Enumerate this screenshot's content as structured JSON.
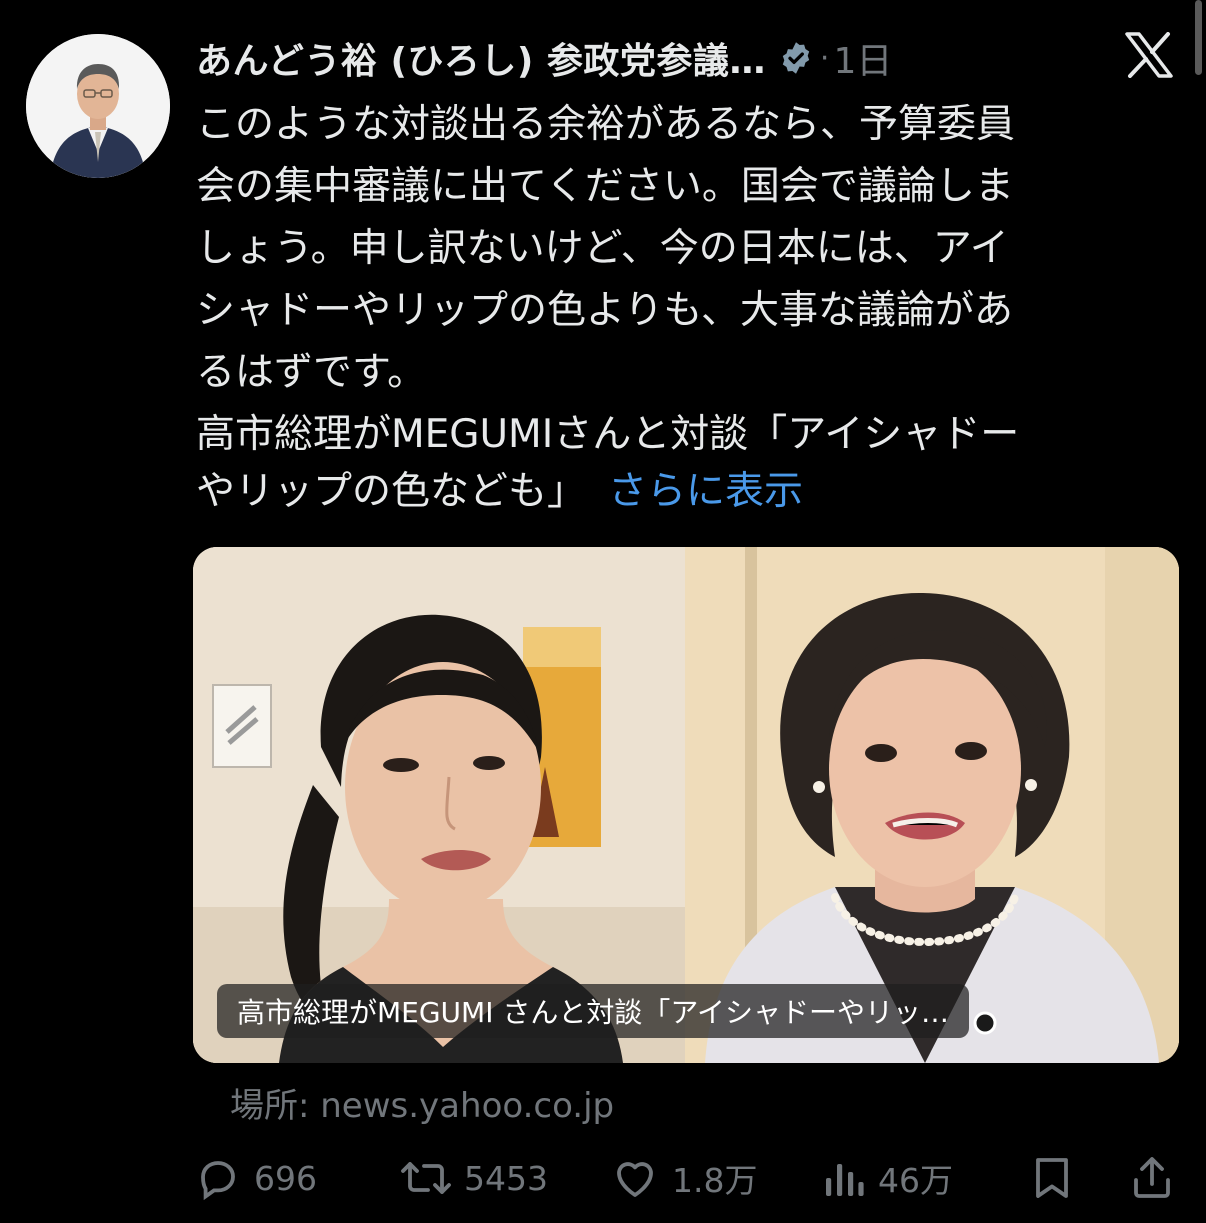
{
  "tweet": {
    "author_name": "あんどう裕 (ひろし) 参政党参議…",
    "separator": "·",
    "time": "1日",
    "body": "このような対談出る余裕があるなら、予算委員\n会の集中審議に出てください。国会で議論しま\nしょう。申し訳ないけど、今の日本には、アイ\nシャドーやリップの色よりも、大事な議論があ\nるはずです。",
    "quote_text_line1": "高市総理がMEGUMIさんと対談「アイシャドー",
    "quote_text_line2": "やリップの色なども」",
    "show_more": "さらに表示"
  },
  "card": {
    "caption": "高市総理がMEGUMI さんと対談「アイシャドーやリッ…",
    "source": "場所: news.yahoo.co.jp"
  },
  "actions": {
    "replies": "696",
    "reposts": "5453",
    "likes": "1.8万",
    "views": "46万"
  },
  "colors": {
    "background": "#000000",
    "text": "#e7e9ea",
    "muted": "#71767b",
    "link": "#4a99e9",
    "verified": "#829aab"
  },
  "icons": [
    "verified-badge-icon",
    "x-logo-icon",
    "reply-icon",
    "repost-icon",
    "like-icon",
    "views-icon",
    "bookmark-icon",
    "share-icon"
  ]
}
